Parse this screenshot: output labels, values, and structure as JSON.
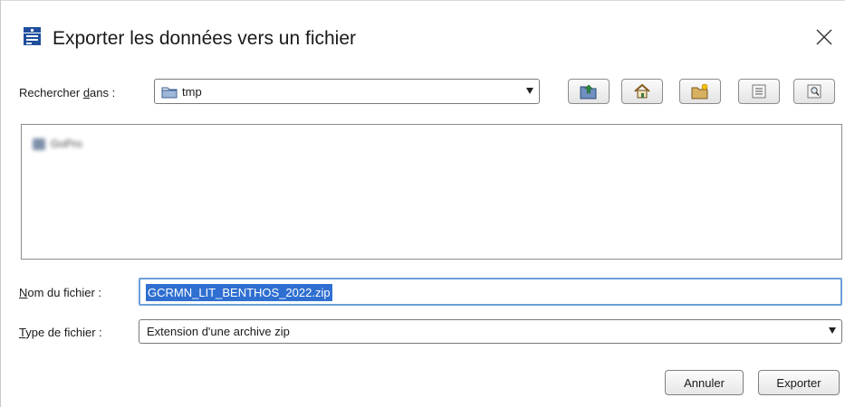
{
  "window": {
    "title": "Exporter les données vers un fichier",
    "icon": "export-data-icon",
    "close_icon": "close-icon"
  },
  "lookin": {
    "label_prefix": "Rechercher ",
    "label_mnemonic": "d",
    "label_suffix": "ans :",
    "value": "tmp"
  },
  "toolbar": {
    "buttons": [
      {
        "icon": "up-one-level-icon"
      },
      {
        "icon": "home-icon"
      },
      {
        "icon": "new-folder-icon"
      },
      {
        "icon": "list-view-icon"
      },
      {
        "icon": "details-view-icon"
      }
    ]
  },
  "file_list": {
    "items": [
      {
        "name": "GoPro",
        "icon": "folder-icon"
      }
    ]
  },
  "filename": {
    "label_mnemonic": "N",
    "label_rest": "om du fichier :",
    "value": "GCRMN_LIT_BENTHOS_2022.zip"
  },
  "filetype": {
    "label_mnemonic": "T",
    "label_rest": "ype de fichier :",
    "value": "Extension d'une archive zip"
  },
  "actions": {
    "cancel_label": "Annuler",
    "export_label": "Exporter"
  }
}
